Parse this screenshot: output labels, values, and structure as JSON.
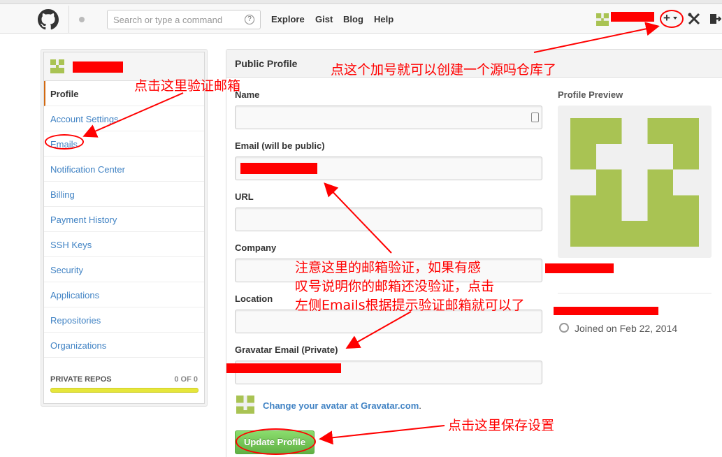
{
  "header": {
    "search_placeholder": "Search or type a command",
    "search_help": "?",
    "nav": [
      "Explore",
      "Gist",
      "Blog",
      "Help"
    ],
    "plus_label": "+"
  },
  "sidebar": {
    "items": [
      {
        "label": "Profile",
        "selected": true
      },
      {
        "label": "Account Settings"
      },
      {
        "label": "Emails"
      },
      {
        "label": "Notification Center"
      },
      {
        "label": "Billing"
      },
      {
        "label": "Payment History"
      },
      {
        "label": "SSH Keys"
      },
      {
        "label": "Security"
      },
      {
        "label": "Applications"
      },
      {
        "label": "Repositories"
      },
      {
        "label": "Organizations"
      }
    ],
    "private_repos_label": "PRIVATE REPOS",
    "private_repos_count": "0 OF 0"
  },
  "main": {
    "title": "Public Profile",
    "fields": {
      "name_label": "Name",
      "email_label": "Email (will be public)",
      "url_label": "URL",
      "company_label": "Company",
      "location_label": "Location",
      "gravatar_label": "Gravatar Email (Private)"
    },
    "preview_label": "Profile Preview",
    "joined": "Joined on Feb 22, 2014",
    "gravatar_link": "Change your avatar at Gravatar.com",
    "gravatar_link_dot": ".",
    "update_button": "Update Profile"
  },
  "annotations": {
    "plus_note": "点这个加号就可以创建一个源吗仓库了",
    "emails_note": "点击这里验证邮箱",
    "warn_line1": "注意这里的邮箱验证，如果有感",
    "warn_line2": "叹号说明你的邮箱还没验证，点击",
    "warn_line3": "左侧Emails根据提示验证邮箱就可以了",
    "save_note": "点击这里保存设置"
  },
  "colors": {
    "identicon": "#a9c353",
    "annotation": "#ff0000",
    "link": "#4183c4",
    "button_green": "#60b044"
  }
}
